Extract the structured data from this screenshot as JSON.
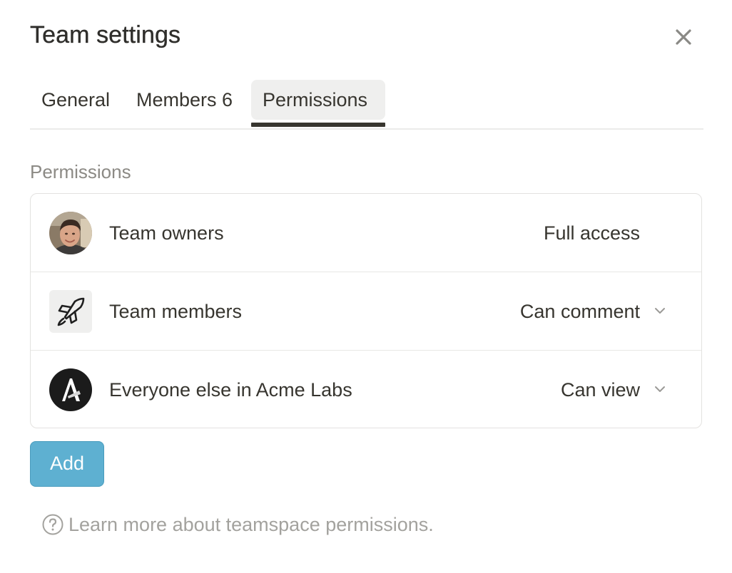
{
  "dialog": {
    "title": "Team settings",
    "close_icon": "close-icon"
  },
  "tabs": [
    {
      "label": "General",
      "active": false
    },
    {
      "label": "Members 6",
      "active": false
    },
    {
      "label": "Permissions",
      "active": true
    }
  ],
  "permissions": {
    "section_label": "Permissions",
    "rows": [
      {
        "label": "Team owners",
        "access": "Full access",
        "icon": "user-avatar",
        "has_dropdown": false
      },
      {
        "label": "Team members",
        "access": "Can comment",
        "icon": "rocket-icon",
        "has_dropdown": true
      },
      {
        "label": "Everyone else in Acme Labs",
        "access": "Can view",
        "icon": "workspace-logo",
        "has_dropdown": true
      }
    ],
    "add_label": "Add"
  },
  "help": {
    "icon": "question-circle-icon",
    "text": "Learn more about teamspace permissions."
  },
  "colors": {
    "accent": "#5eb0d1",
    "text": "#37352f",
    "muted": "#8c8a85"
  }
}
